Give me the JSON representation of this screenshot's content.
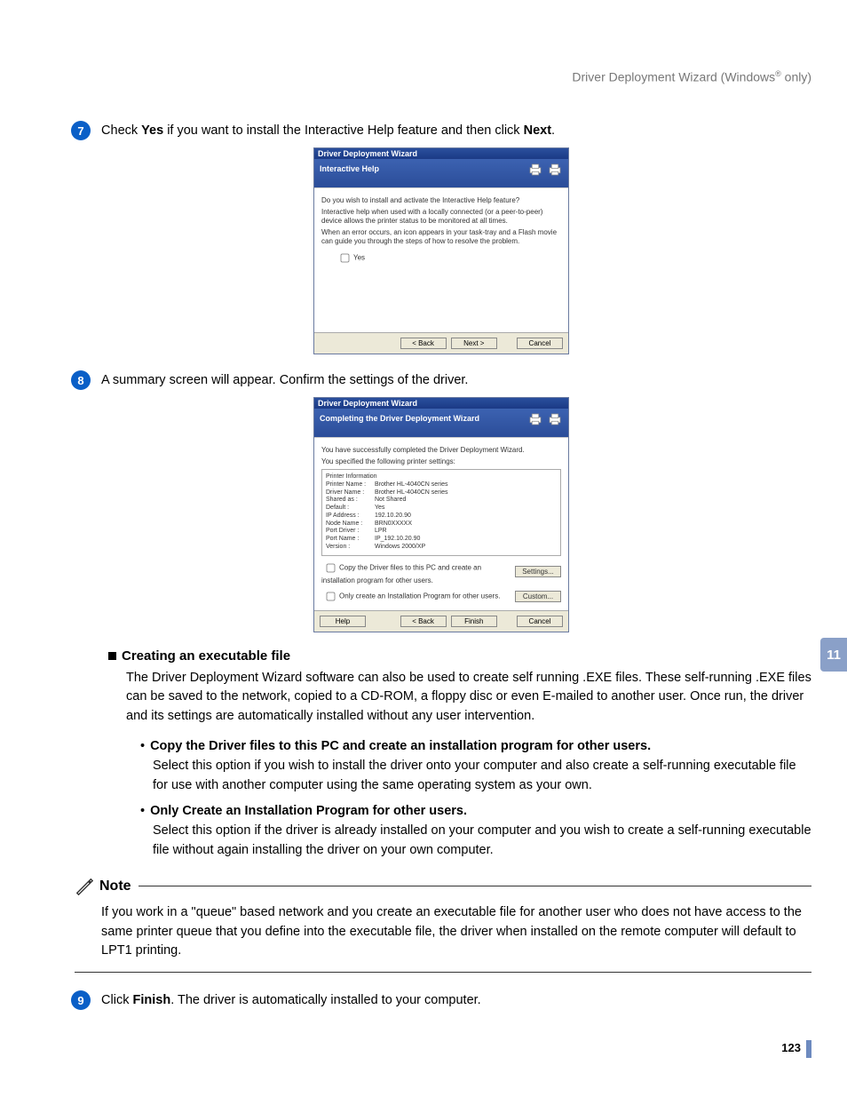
{
  "header": {
    "text_pre": "Driver Deployment Wizard (Windows",
    "text_post": " only)",
    "sup": "®"
  },
  "side_tab": "11",
  "page_number": "123",
  "steps": {
    "s7": {
      "num": "7",
      "text_a": "Check ",
      "bold_a": "Yes",
      "text_b": " if you want to install the Interactive Help feature and then click ",
      "bold_b": "Next",
      "text_c": "."
    },
    "s8": {
      "num": "8",
      "text": "A summary screen will appear. Confirm the settings of the driver."
    },
    "s9": {
      "num": "9",
      "text_a": "Click ",
      "bold_a": "Finish",
      "text_b": ". The driver is automatically installed to your computer."
    }
  },
  "wizard1": {
    "title": "Driver Deployment Wizard",
    "heading": "Interactive Help",
    "p1": "Do you wish to install and activate the Interactive Help feature?",
    "p2": "Interactive help when used with a locally connected (or a peer-to-peer) device allows the printer status to be monitored at all times.",
    "p3": "When an error occurs, an icon appears in your task-tray and a Flash movie can guide you through the steps of how to resolve the problem.",
    "chk_yes": "Yes",
    "btn_back": "< Back",
    "btn_next": "Next >",
    "btn_cancel": "Cancel"
  },
  "wizard2": {
    "title": "Driver Deployment Wizard",
    "heading": "Completing the Driver Deployment Wizard",
    "p1": "You have successfully completed the Driver Deployment Wizard.",
    "p2": "You specified the following printer settings:",
    "info_title": "Printer Information",
    "rows": [
      {
        "l": "Printer Name :",
        "v": "Brother HL-4040CN series"
      },
      {
        "l": "Driver Name :",
        "v": "Brother HL-4040CN series"
      },
      {
        "l": "Shared as :",
        "v": "Not Shared"
      },
      {
        "l": "Default :",
        "v": "Yes"
      },
      {
        "l": "IP Address :",
        "v": "192.10.20.90"
      },
      {
        "l": "Node Name :",
        "v": "BRN0XXXXX"
      },
      {
        "l": "Port Driver :",
        "v": "LPR"
      },
      {
        "l": "Port Name :",
        "v": "IP_192.10.20.90"
      },
      {
        "l": "Version :",
        "v": "Windows 2000/XP"
      }
    ],
    "chk_copy": "Copy the Driver files to this PC and create an installation program for other users.",
    "chk_only": "Only create an Installation Program for other users.",
    "btn_settings": "Settings...",
    "btn_custom": "Custom...",
    "btn_help": "Help",
    "btn_back": "< Back",
    "btn_finish": "Finish",
    "btn_cancel": "Cancel"
  },
  "exec_section": {
    "heading": "Creating an executable file",
    "para": "The Driver Deployment Wizard software can also be used to create self running .EXE files. These self-running .EXE files can be saved to the network, copied to a CD-ROM, a floppy disc or even E-mailed to another user. Once run, the driver and its settings are automatically installed without any user intervention.",
    "b1_title": "Copy the Driver files to this PC and create an installation program for other users.",
    "b1_text": "Select this option if you wish to install the driver onto your computer and also create a self-running executable file for use with another computer using the same operating system as your own.",
    "b2_title": "Only Create an Installation Program for other users.",
    "b2_text": "Select this option if the driver is already installed on your computer and you wish to create a self-running executable file without again installing the driver on your own computer."
  },
  "note": {
    "label": "Note",
    "body": "If you work in a \"queue\" based network and you create an executable file for another user who does not have access to the same printer queue that you define into the executable file, the driver when installed on the remote computer will default to LPT1 printing."
  }
}
